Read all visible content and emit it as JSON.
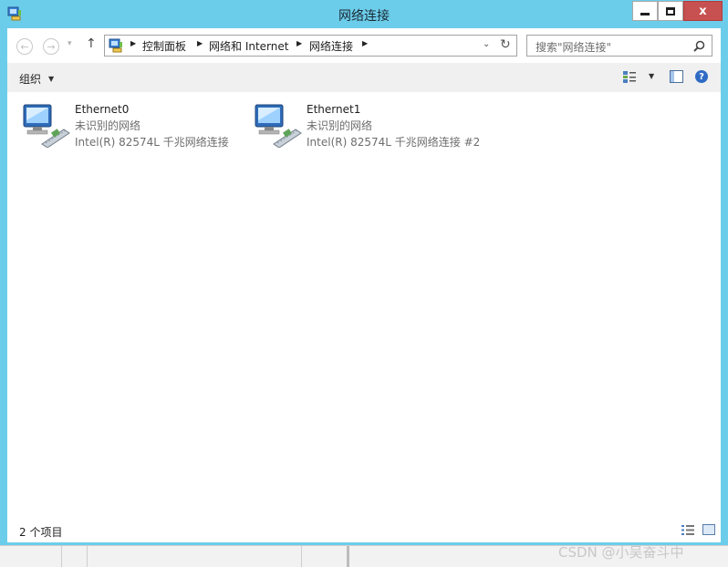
{
  "window": {
    "title": "网络连接",
    "minimize_glyph": "minimize",
    "maximize_glyph": "maximize",
    "close_label": "x"
  },
  "navigation": {
    "back_glyph": "←",
    "forward_glyph": "→",
    "history_glyph": "▾",
    "up_glyph": "↑"
  },
  "address": {
    "breadcrumbs": [
      "控制面板",
      "网络和 Internet",
      "网络连接"
    ],
    "refresh_glyph": "↻"
  },
  "search": {
    "placeholder": "搜索\"网络连接\""
  },
  "toolbar": {
    "organize_label": "组织",
    "help_label": "?"
  },
  "items": [
    {
      "name": "Ethernet0",
      "status": "未识别的网络",
      "adapter": "Intel(R) 82574L 千兆网络连接"
    },
    {
      "name": "Ethernet1",
      "status": "未识别的网络",
      "adapter": "Intel(R) 82574L 千兆网络连接 #2"
    }
  ],
  "statusbar": {
    "count_text": "2 个项目"
  },
  "watermark": "CSDN @小吴奋斗中",
  "colors": {
    "window_frame": "#6ccdea",
    "close_button": "#c75050",
    "toolbar_bg": "#f0f0f0",
    "secondary_text": "#6d6d6d"
  },
  "icons": {
    "app": "network-connections-icon",
    "item": "network-adapter-icon",
    "search": "search-icon",
    "help": "help-icon",
    "view": "change-view-icon",
    "preview_pane": "preview-pane-icon"
  }
}
